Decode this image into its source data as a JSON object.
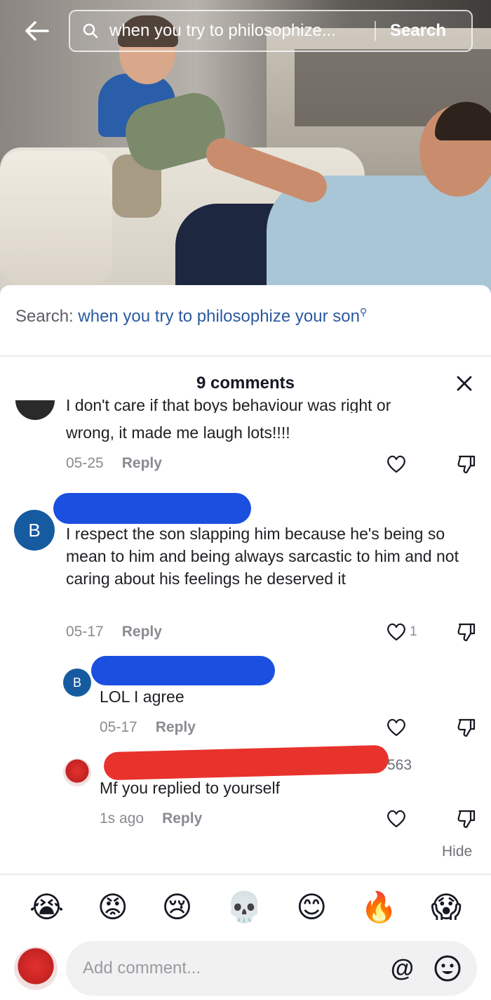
{
  "topbar": {
    "query": "when you try to philosophize...",
    "search_label": "Search"
  },
  "search_suggestion": {
    "label": "Search: ",
    "term": "when you try to philosophize your son",
    "icon": "search-icon"
  },
  "comments_header": {
    "title": "9 comments"
  },
  "comments": [
    {
      "text_partial": "I don't care if that boys behaviour was right or",
      "text": "wrong, it made me laugh lots!!!!",
      "date": "05-25",
      "reply_label": "Reply",
      "likes": ""
    },
    {
      "avatar_letter": "B",
      "text": "I respect the son slapping him because he's being so mean to him and being always sarcastic to him and not caring about his feelings he deserved it",
      "date": "05-17",
      "reply_label": "Reply",
      "likes": "1"
    }
  ],
  "replies": [
    {
      "avatar_letter": "B",
      "text": "LOL I agree",
      "date": "05-17",
      "reply_label": "Reply"
    },
    {
      "name_fragment": "563",
      "text": "Mf you replied to yourself",
      "date": "1s ago",
      "reply_label": "Reply"
    }
  ],
  "hide_label": "Hide",
  "reactions": [
    "😭",
    "😡",
    "😢",
    "💀",
    "😊",
    "🔥",
    "😱"
  ],
  "composer": {
    "placeholder": "Add comment...",
    "at_label": "@"
  },
  "colors": {
    "link_blue": "#2b5aa0",
    "avatar_blue": "#165ba0",
    "redaction_blue": "#1a4fe0",
    "redaction_red": "#e8322c"
  }
}
